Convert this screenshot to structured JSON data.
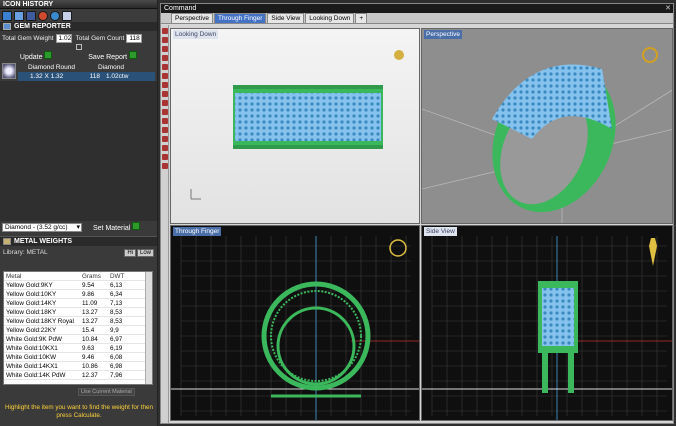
{
  "app": {
    "icon_history_title": "ICON HISTORY"
  },
  "gem_reporter": {
    "title": "GEM REPORTER",
    "total_weight_label": "Total Gem Weight",
    "total_weight_value": "1.02",
    "total_count_label": "Total Gem Count",
    "total_count_value": "118",
    "update_label": "Update",
    "save_report_label": "Save Report",
    "gem": {
      "shape": "Diamond Round",
      "material": "Diamond",
      "size": "1.32 X 1.32",
      "count": "118",
      "weight": "1.02ctw"
    },
    "material_select": "Diamond - (3.52 g/cc)",
    "set_material_label": "Set Material"
  },
  "metal_weights": {
    "title": "METAL WEIGHTS",
    "library": "Library: METAL",
    "hi_label": "Hi",
    "low_label": "Low",
    "columns": [
      "Metal",
      "Grams",
      "DWT"
    ],
    "rows": [
      [
        "Yellow Gold:9KY",
        "9.54",
        "6,13"
      ],
      [
        "Yellow Gold:10KY",
        "9.86",
        "6,34"
      ],
      [
        "Yellow Gold:14KY",
        "11.09",
        "7,13"
      ],
      [
        "Yellow Gold:18KY",
        "13.27",
        "8,53"
      ],
      [
        "Yellow Gold:18KY Royal",
        "13.27",
        "8,53"
      ],
      [
        "Yellow Gold:22KY",
        "15.4",
        "9,9"
      ],
      [
        "White Gold:9K PdW",
        "10.84",
        "6,97"
      ],
      [
        "White Gold:10KX1",
        "9.63",
        "6,19"
      ],
      [
        "White Gold:10KW",
        "9.46",
        "6,08"
      ],
      [
        "White Gold:14KX1",
        "10.86",
        "6,98"
      ],
      [
        "White Gold:14K PdW",
        "12.37",
        "7,96"
      ]
    ],
    "custom_button": "Use Current Material",
    "hint": "Highlight the item you want to find the weight for then press Calculate."
  },
  "command_bar": {
    "title": "Command"
  },
  "tabs": [
    "Perspective",
    "Through Finger",
    "Side View",
    "Looking Down",
    "+"
  ],
  "viewports": {
    "looking_down": "Looking Down",
    "perspective": "Perspective",
    "through_finger": "Through Finger",
    "side_view": "Side View"
  },
  "colors": {
    "ring": "#3cb85c",
    "gems": "#7ab8e8",
    "grid_bg": "#0f0f0f",
    "active_tab": "#4472c4"
  }
}
